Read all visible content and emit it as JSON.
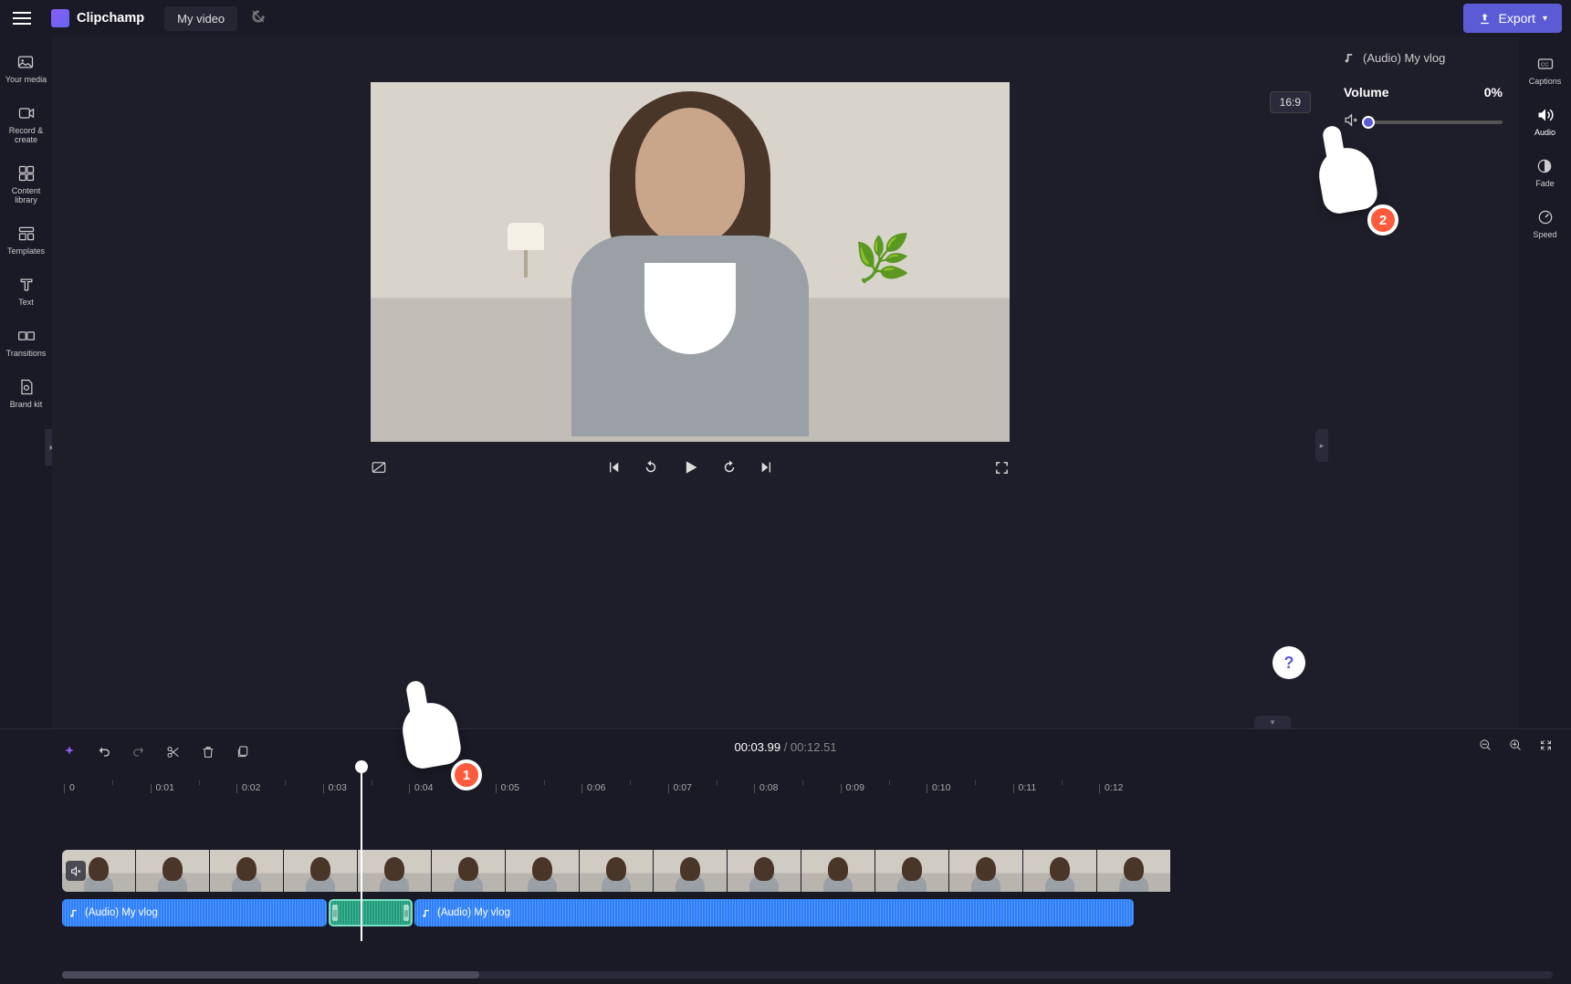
{
  "app": {
    "name": "Clipchamp",
    "project_title": "My video"
  },
  "export": {
    "label": "Export"
  },
  "left_rail": [
    {
      "label": "Your media"
    },
    {
      "label": "Record & create"
    },
    {
      "label": "Content library"
    },
    {
      "label": "Templates"
    },
    {
      "label": "Text"
    },
    {
      "label": "Transitions"
    },
    {
      "label": "Brand kit"
    }
  ],
  "preview": {
    "aspect": "16:9"
  },
  "right_rail": [
    {
      "label": "Captions"
    },
    {
      "label": "Audio"
    },
    {
      "label": "Fade"
    },
    {
      "label": "Speed"
    }
  ],
  "property_panel": {
    "clip_title": "(Audio) My vlog",
    "volume_label": "Volume",
    "volume_value": "0%"
  },
  "timeline": {
    "current_time": "00:03.99",
    "duration": "00:12.51",
    "ruler": [
      "0",
      "0:01",
      "0:02",
      "0:03",
      "0:04",
      "0:05",
      "0:06",
      "0:07",
      "0:08",
      "0:09",
      "0:10",
      "0:11",
      "0:12"
    ],
    "audio_clips": [
      {
        "label": "(Audio) My vlog"
      },
      {
        "label": ""
      },
      {
        "label": "(Audio) My vlog"
      }
    ]
  },
  "pointers": {
    "one": "1",
    "two": "2"
  }
}
